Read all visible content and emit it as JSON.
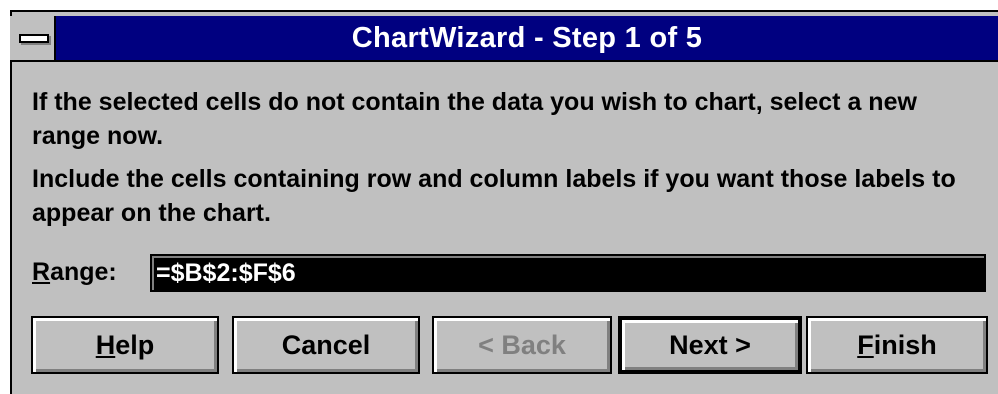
{
  "window": {
    "title": "ChartWizard - Step 1 of 5",
    "title_bar_color": "#000080",
    "face_color": "#c0c0c0"
  },
  "system_menu": {
    "icon": "system-menu-icon"
  },
  "instructions": {
    "line1": "If the selected cells do not contain the data you wish to chart, select a new range now.",
    "line2": "Include the cells containing row and column labels if you want those labels to appear on the chart."
  },
  "range": {
    "label_accel": "R",
    "label_rest": "ange:",
    "value": "=$B$2:$F$6"
  },
  "buttons": {
    "help": {
      "accel": "H",
      "rest": "elp"
    },
    "cancel": {
      "label": "Cancel"
    },
    "back": {
      "label": "< Back",
      "disabled": true
    },
    "next": {
      "label": "Next >",
      "default": true
    },
    "finish": {
      "accel": "F",
      "rest": "inish"
    }
  }
}
